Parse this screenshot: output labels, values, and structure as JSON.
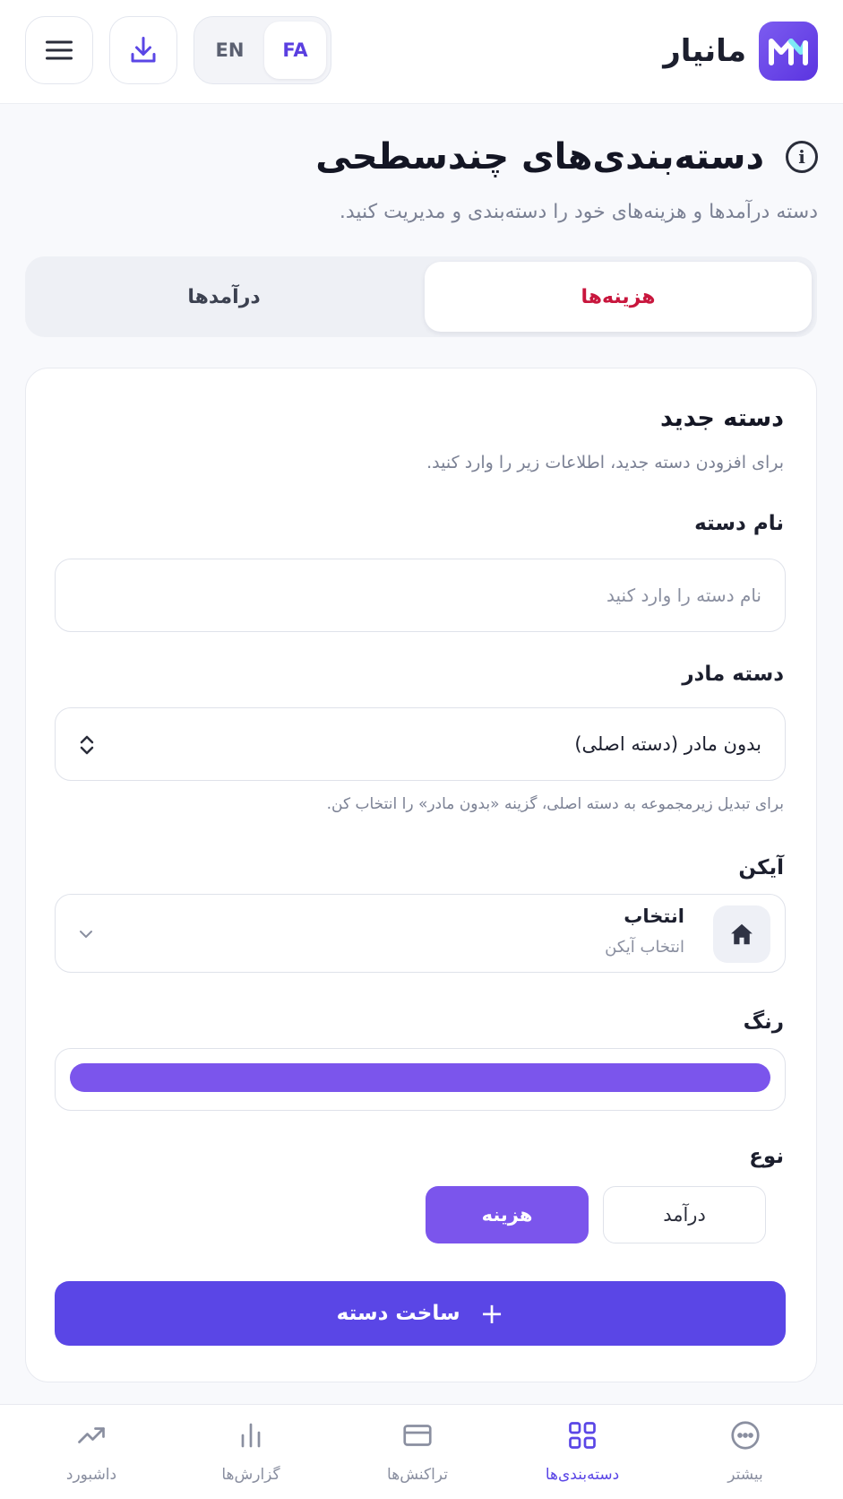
{
  "app": {
    "name": "مانیار"
  },
  "header": {
    "lang_en": "EN",
    "lang_fa": "FA",
    "active_lang": "FA"
  },
  "page": {
    "title": "دسته‌بندی‌های چندسطحی",
    "subtitle": "دسته درآمدها و هزینه‌های خود را دسته‌بندی و مدیریت کنید."
  },
  "tabs": [
    {
      "label": "هزینه‌ها",
      "active": true
    },
    {
      "label": "درآمدها",
      "active": false
    }
  ],
  "form": {
    "title": "دسته جدید",
    "description": "برای افزودن دسته جدید، اطلاعات زیر را وارد کنید.",
    "name_label": "نام دسته",
    "name_placeholder": "نام دسته را وارد کنید",
    "name_value": "",
    "parent_label": "دسته مادر",
    "parent_value": "بدون مادر (دسته اصلی)",
    "parent_hint": "برای تبدیل زیرمجموعه به دسته اصلی، گزینه «بدون مادر» را انتخاب کن.",
    "icon_label": "آیکن",
    "icon_title": "انتخاب",
    "icon_subtitle": "انتخاب آیکن",
    "icon_name": "home-icon",
    "color_label": "رنگ",
    "color_value": "#7b55ec",
    "type_label": "نوع",
    "type_income": "درآمد",
    "type_expense": "هزینه",
    "type_selected": "هزینه",
    "submit_label": "ساخت دسته"
  },
  "bottom_nav": [
    {
      "label": "بیشتر",
      "icon": "more-icon",
      "active": false
    },
    {
      "label": "دسته‌بندی‌ها",
      "icon": "grid-icon",
      "active": true
    },
    {
      "label": "تراکنش‌ها",
      "icon": "card-icon",
      "active": false
    },
    {
      "label": "گزارش‌ها",
      "icon": "bar-chart-icon",
      "active": false
    },
    {
      "label": "داشبورد",
      "icon": "trend-icon",
      "active": false
    }
  ],
  "colors": {
    "accent": "#5a46e6",
    "expense_active": "#c8163d",
    "purple": "#7b55ec"
  }
}
